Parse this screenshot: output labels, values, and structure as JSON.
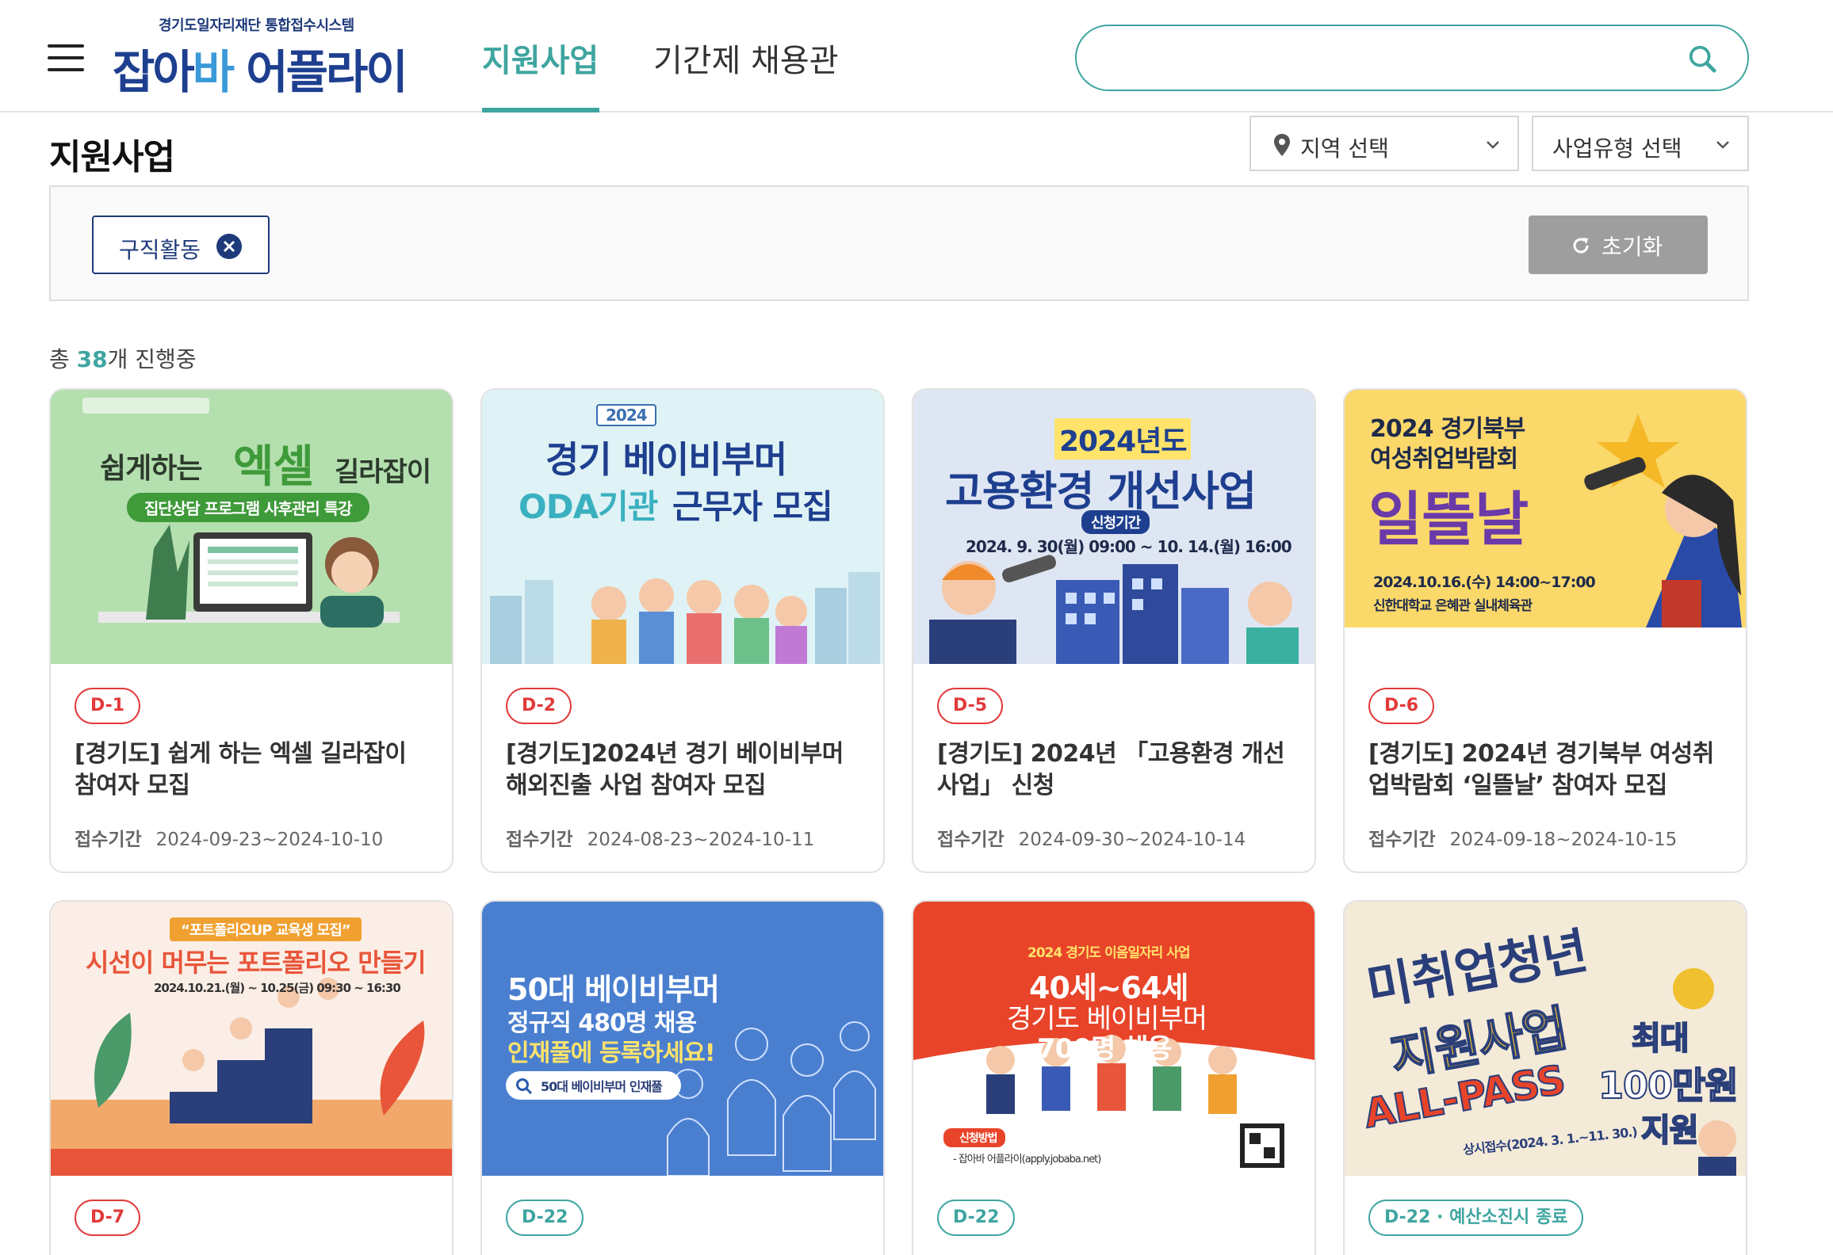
{
  "header": {
    "logo_sub": "경기도일자리재단 통합접수시스템",
    "logo_main_a": "잡아",
    "logo_main_b": "바",
    "logo_main_c": " 어플라이",
    "nav": [
      "지원사업",
      "기간제 채용관"
    ],
    "search_placeholder": ""
  },
  "page": {
    "title": "지원사업",
    "region_select": "지역 선택",
    "type_select": "사업유형 선택",
    "filter_chip": "구직활동",
    "reset_label": "초기화",
    "count_prefix": "총 ",
    "count_num": "38",
    "count_suffix": "개 진행중"
  },
  "colors": {
    "accent": "#3fa5a0",
    "brand": "#1e3a7a",
    "deadline": "#e23a3a"
  },
  "cards": [
    {
      "badge": "D-1",
      "title": "[경기도] 쉽게 하는 엑셀 길라잡이 참여자 모집",
      "period_label": "접수기간",
      "period": "2024-09-23~2024-10-10",
      "thumb": {
        "l1": "쉽게하는",
        "l2": "엑셀",
        "l3": "길라잡이",
        "l4": "집단상담 프로그램 사후관리 특강"
      }
    },
    {
      "badge": "D-2",
      "title": "[경기도]2024년 경기 베이비부머 해외진출 사업 참여자 모집",
      "period_label": "접수기간",
      "period": "2024-08-23~2024-10-11",
      "thumb": {
        "l1": "2024",
        "l2": "경기 베이비부머",
        "l3": "ODA기관",
        "l4": "근무자 모집"
      }
    },
    {
      "badge": "D-5",
      "title": "[경기도] 2024년 「고용환경 개선사업」 신청",
      "period_label": "접수기간",
      "period": "2024-09-30~2024-10-14",
      "thumb": {
        "l1": "2024년도",
        "l2": "고용환경 개선사업",
        "l3": "신청기간",
        "l4": "2024. 9. 30(월) 09:00 ~ 10. 14.(월) 16:00"
      }
    },
    {
      "badge": "D-6",
      "title": "[경기도] 2024년 경기북부 여성취업박람회 ‘일뜰날’ 참여자 모집",
      "period_label": "접수기간",
      "period": "2024-09-18~2024-10-15",
      "thumb": {
        "l1": "2024 경기북부",
        "l2": "여성취업박람회",
        "l3": "일뜰날",
        "l4": "2024.10.16.(수) 14:00~17:00",
        "l5": "신한대학교 은혜관 실내체육관"
      }
    },
    {
      "badge": "D-7",
      "thumb": {
        "l1": "“포트폴리오UP 교육생 모집”",
        "l2": "시선이 머무는 포트폴리오 만들기",
        "l3": "2024.10.21.(월) ~ 10.25(금) 09:30 ~ 16:30"
      }
    },
    {
      "badge": "D-22",
      "thumb": {
        "l1": "50대 베이비부머",
        "l2": "정규직 480명 채용",
        "l3": "인재풀에 등록하세요!",
        "l4": "50대 베이비부머 인재풀"
      }
    },
    {
      "badge": "D-22",
      "thumb": {
        "l1": "2024 경기도 이음일자리 사업",
        "l2": "40세~64세",
        "l3": "경기도 베이비부머",
        "l4": "700명 채용",
        "l5": "신청방법",
        "l6": "- 잡아바 어플라이(apply.jobaba.net)"
      }
    },
    {
      "badge": "D-22 · 예산소진시 종료",
      "thumb": {
        "l1": "미취업청년",
        "l2": "지원사업",
        "l3": "ALL-PASS",
        "l4": "최대",
        "l5": "100만원",
        "l6": "지원",
        "l7": "상시접수(2024. 3. 1.~11. 30.)"
      }
    }
  ]
}
